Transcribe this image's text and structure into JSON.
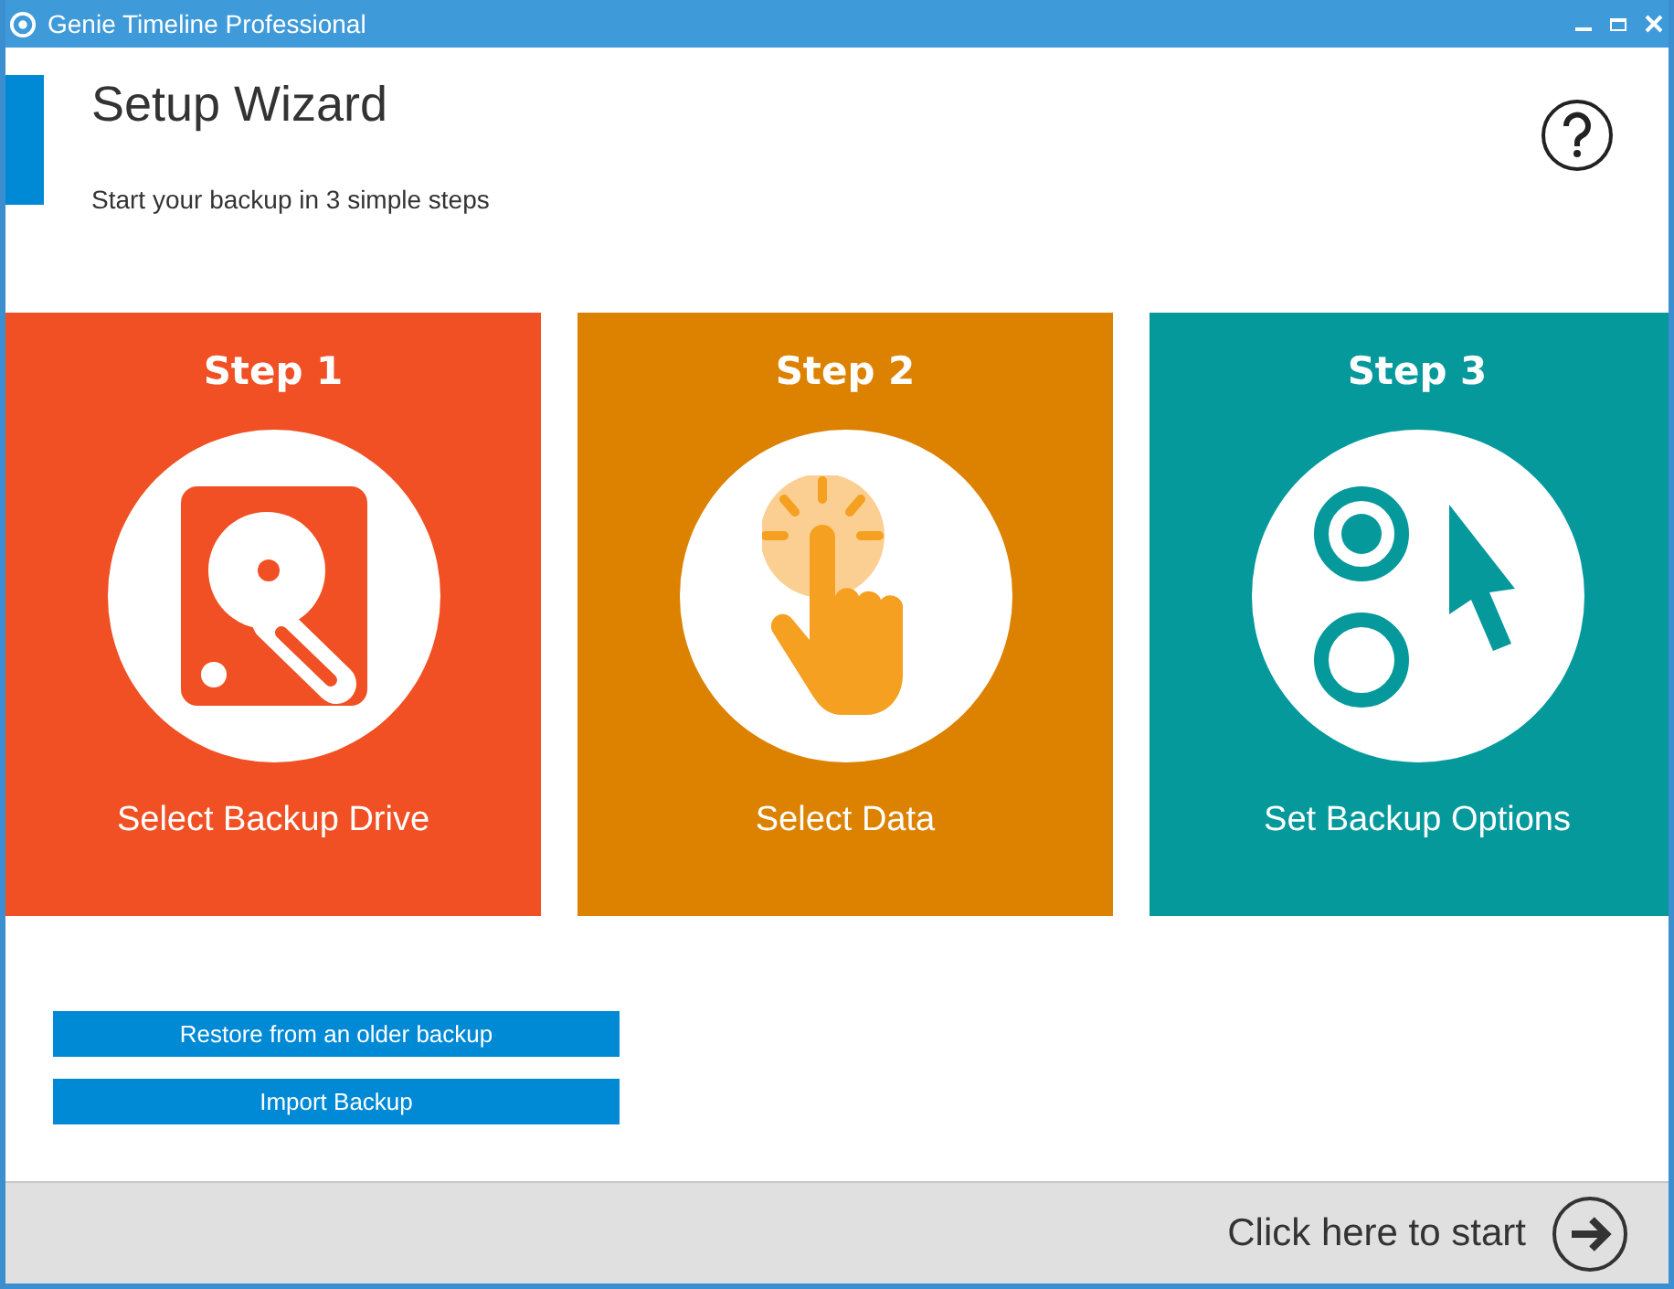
{
  "window": {
    "title": "Genie Timeline Professional"
  },
  "header": {
    "title": "Setup Wizard",
    "subtitle": "Start your backup in 3 simple steps"
  },
  "steps": [
    {
      "label": "Step 1",
      "caption": "Select Backup Drive",
      "kind": "drive",
      "color": "#f05023"
    },
    {
      "label": "Step 2",
      "caption": "Select Data",
      "kind": "data",
      "color": "#dc8200"
    },
    {
      "label": "Step 3",
      "caption": "Set Backup Options",
      "kind": "options",
      "color": "#05999c"
    }
  ],
  "buttons": [
    "Restore from an older backup",
    "Import Backup"
  ],
  "footer": {
    "start": "Click here to start"
  }
}
